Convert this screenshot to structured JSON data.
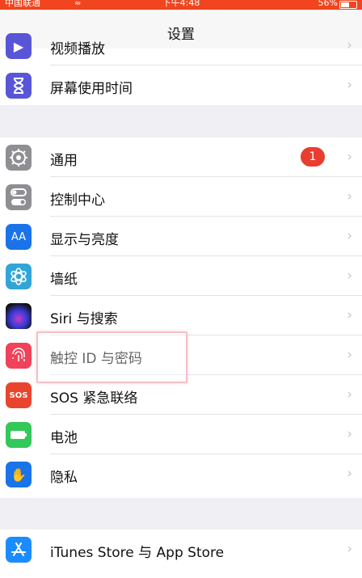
{
  "status_bar": {
    "carrier": "中国联通",
    "time": "下午4:48",
    "battery": "56%"
  },
  "nav": {
    "title": "设置"
  },
  "colors": {
    "status_bar": "#f0451f",
    "accent_badge": "#e93d30",
    "background": "#efeff4"
  },
  "group0": {
    "items": [
      {
        "label": "视频播放",
        "icon": "video-icon",
        "color": "#5856d6"
      },
      {
        "label": "屏幕使用时间",
        "icon": "hourglass-icon",
        "color": "#5856d6"
      }
    ]
  },
  "group1": {
    "items": [
      {
        "label": "通用",
        "icon": "gear-icon",
        "color": "#8e8e93",
        "badge": "1"
      },
      {
        "label": "控制中心",
        "icon": "toggle-icon",
        "color": "#8e8e93"
      },
      {
        "label": "显示与亮度",
        "icon": "text-size-icon",
        "color": "#1a73e8",
        "glyph": "AA"
      },
      {
        "label": "墙纸",
        "icon": "flower-icon",
        "color": "#32a5d8"
      },
      {
        "label": "Siri 与搜索",
        "icon": "siri-icon",
        "color": "#1c1c3a"
      },
      {
        "label": "触控 ID 与密码",
        "icon": "fingerprint-icon",
        "color": "#f0425a"
      },
      {
        "label": "SOS 紧急联络",
        "icon": "sos-icon",
        "color": "#e9452e",
        "glyph": "SOS"
      },
      {
        "label": "电池",
        "icon": "battery-icon",
        "color": "#34c759"
      },
      {
        "label": "隐私",
        "icon": "hand-icon",
        "color": "#1a73e8"
      }
    ]
  },
  "group2": {
    "items": [
      {
        "label": "iTunes Store 与 App Store",
        "icon": "app-store-icon",
        "color": "#1a8cff"
      }
    ]
  }
}
